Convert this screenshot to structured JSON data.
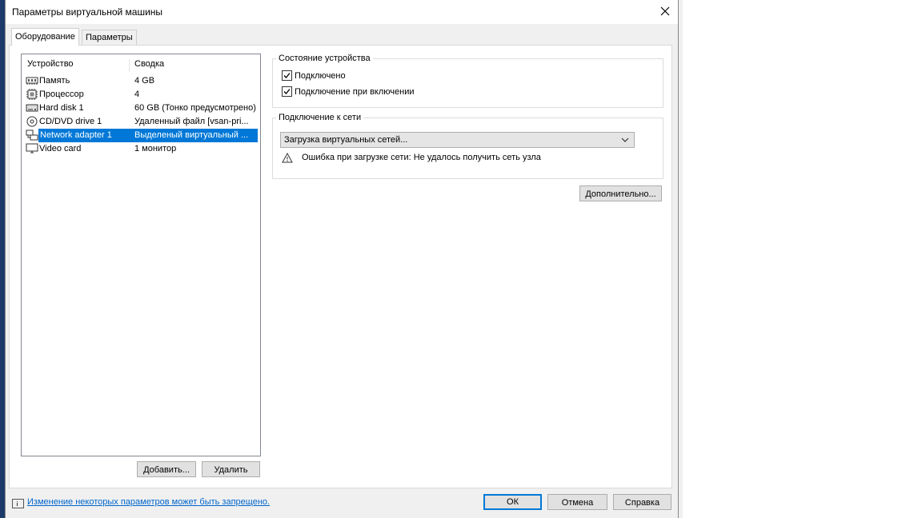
{
  "dialog": {
    "title": "Параметры виртуальной машины",
    "tabs": [
      {
        "label": "Оборудование",
        "active": true
      },
      {
        "label": "Параметры",
        "active": false
      }
    ]
  },
  "devices": {
    "columns": [
      "Устройство",
      "Сводка"
    ],
    "rows": [
      {
        "icon": "memory-icon",
        "name": "Память",
        "summary": "4 GB",
        "selected": false
      },
      {
        "icon": "processor-icon",
        "name": "Процессор",
        "summary": "4",
        "selected": false
      },
      {
        "icon": "hard-disk-icon",
        "name": "Hard disk 1",
        "summary": "60 GB (Тонко предусмотрено)",
        "selected": false
      },
      {
        "icon": "cd-dvd-icon",
        "name": "CD/DVD drive 1",
        "summary": "Удаленный файл [vsan-pri...",
        "selected": false
      },
      {
        "icon": "network-adapter-icon",
        "name": "Network adapter 1",
        "summary": "Выделеный виртуальный ...",
        "selected": true
      },
      {
        "icon": "monitor-icon",
        "name": "Video card",
        "summary": "1 монитор",
        "selected": false
      }
    ],
    "add_label": "Добавить...",
    "remove_label": "Удалить"
  },
  "device_status": {
    "title": "Состояние устройства",
    "connected": {
      "label": "Подключено",
      "checked": true
    },
    "connect_at_power_on": {
      "label": "Подключение при включении",
      "checked": true
    }
  },
  "network": {
    "title": "Подключение к сети",
    "select_value": "Загрузка виртуальных сетей...",
    "error": "Ошибка при загрузке сети: Не удалось получить сеть узла"
  },
  "advanced_label": "Дополнительно...",
  "footer": {
    "info_link": "Изменение некоторых параметров может быть запрещено.",
    "ok_label": "ОК",
    "cancel_label": "Отмена",
    "help_label": "Справка"
  }
}
